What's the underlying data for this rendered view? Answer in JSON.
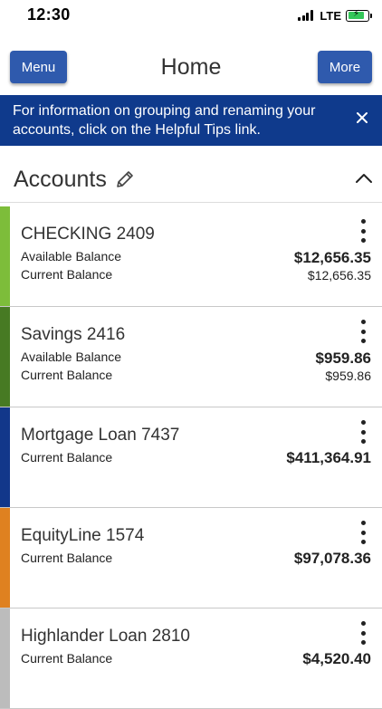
{
  "status": {
    "time": "12:30",
    "network": "LTE"
  },
  "header": {
    "menu_label": "Menu",
    "title": "Home",
    "more_label": "More"
  },
  "banner": {
    "text": "For information on grouping and renaming your accounts, click on the Helpful Tips link."
  },
  "accounts_header": {
    "title": "Accounts"
  },
  "accounts": [
    {
      "name": "CHECKING 2409",
      "color": "#7dbd3a",
      "lines": [
        {
          "label": "Available Balance",
          "amount": "$12,656.35"
        },
        {
          "label": "Current Balance",
          "amount": "$12,656.35"
        }
      ]
    },
    {
      "name": "Savings 2416",
      "color": "#477a23",
      "lines": [
        {
          "label": "Available Balance",
          "amount": "$959.86"
        },
        {
          "label": "Current Balance",
          "amount": "$959.86"
        }
      ]
    },
    {
      "name": "Mortgage Loan 7437",
      "color": "#12378a",
      "lines": [
        {
          "label": "Current Balance",
          "amount": "$411,364.91"
        }
      ]
    },
    {
      "name": "EquityLine 1574",
      "color": "#df8120",
      "lines": [
        {
          "label": "Current Balance",
          "amount": "$97,078.36"
        }
      ]
    },
    {
      "name": "Highlander Loan 2810",
      "color": "#bcbcbc",
      "lines": [
        {
          "label": "Current Balance",
          "amount": "$4,520.40"
        }
      ]
    }
  ],
  "colors": {
    "primary_button": "#2f5aad",
    "banner_bg": "#0f3a8c",
    "battery": "#34c759"
  },
  "icons": [
    "signal-icon",
    "battery-charging-icon",
    "close-icon",
    "pencil-edit-icon",
    "chevron-up-icon",
    "more-vertical-icon"
  ]
}
